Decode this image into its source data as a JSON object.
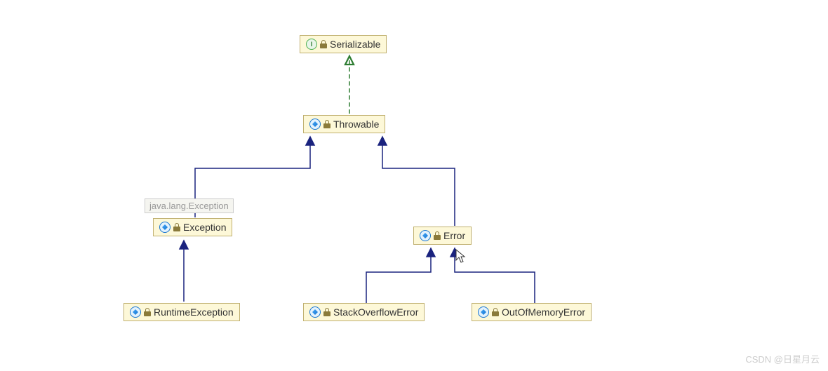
{
  "nodes": {
    "serializable": {
      "label": "Serializable",
      "type": "interface"
    },
    "throwable": {
      "label": "Throwable",
      "type": "class"
    },
    "exception": {
      "label": "Exception",
      "type": "class"
    },
    "error": {
      "label": "Error",
      "type": "class"
    },
    "runtimeexception": {
      "label": "RuntimeException",
      "type": "class"
    },
    "stackoverflowerror": {
      "label": "StackOverflowError",
      "type": "class"
    },
    "outofmemoryerror": {
      "label": "OutOfMemoryError",
      "type": "class"
    }
  },
  "tooltip": {
    "text": "java.lang.Exception"
  },
  "watermark": "CSDN @日星月云",
  "chart_data": {
    "type": "diagram",
    "subtype": "uml-class-hierarchy",
    "nodes": [
      {
        "id": "Serializable",
        "kind": "interface"
      },
      {
        "id": "Throwable",
        "kind": "class"
      },
      {
        "id": "Exception",
        "kind": "class"
      },
      {
        "id": "Error",
        "kind": "class"
      },
      {
        "id": "RuntimeException",
        "kind": "class"
      },
      {
        "id": "StackOverflowError",
        "kind": "class"
      },
      {
        "id": "OutOfMemoryError",
        "kind": "class"
      }
    ],
    "edges": [
      {
        "from": "Throwable",
        "to": "Serializable",
        "relation": "implements"
      },
      {
        "from": "Exception",
        "to": "Throwable",
        "relation": "extends"
      },
      {
        "from": "Error",
        "to": "Throwable",
        "relation": "extends"
      },
      {
        "from": "RuntimeException",
        "to": "Exception",
        "relation": "extends"
      },
      {
        "from": "StackOverflowError",
        "to": "Error",
        "relation": "extends"
      },
      {
        "from": "OutOfMemoryError",
        "to": "Error",
        "relation": "extends"
      }
    ]
  }
}
